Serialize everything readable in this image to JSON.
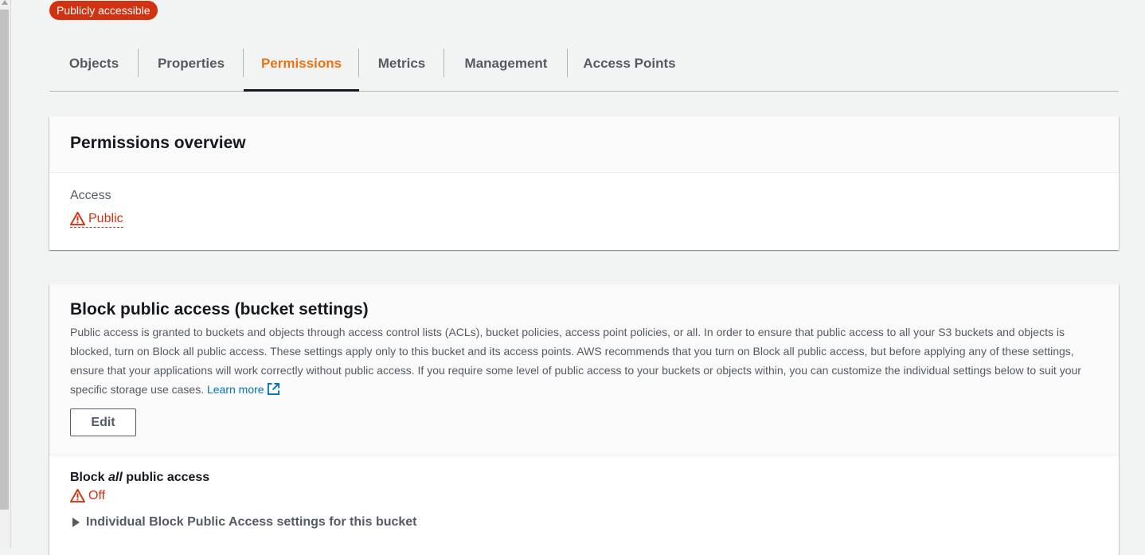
{
  "badge": {
    "label": "Publicly accessible",
    "color": "#d13212"
  },
  "tabs": [
    {
      "label": "Objects",
      "active": false
    },
    {
      "label": "Properties",
      "active": false
    },
    {
      "label": "Permissions",
      "active": true
    },
    {
      "label": "Metrics",
      "active": false
    },
    {
      "label": "Management",
      "active": false
    },
    {
      "label": "Access Points",
      "active": false
    }
  ],
  "overview": {
    "title": "Permissions overview",
    "access_label": "Access",
    "access_value": "Public",
    "access_icon": "warning-icon"
  },
  "block": {
    "title": "Block public access (bucket settings)",
    "description": "Public access is granted to buckets and objects through access control lists (ACLs), bucket policies, access point policies, or all. In order to ensure that public access to all your S3 buckets and objects is blocked, turn on Block all public access. These settings apply only to this bucket and its access points. AWS recommends that you turn on Block all public access, but before applying any of these settings, ensure that your applications will work correctly without public access. If you require some level of public access to your buckets or objects within, you can customize the individual settings below to suit your specific storage use cases.",
    "learn_more": "Learn more",
    "learn_more_icon": "external-link-icon",
    "edit_label": "Edit",
    "setting_prefix": "Block ",
    "setting_em": "all",
    "setting_suffix": " public access",
    "setting_value": "Off",
    "expander_label": "Individual Block Public Access settings for this bucket"
  },
  "colors": {
    "accent": "#ec7211",
    "error": "#d13212",
    "link": "#0073bb"
  }
}
